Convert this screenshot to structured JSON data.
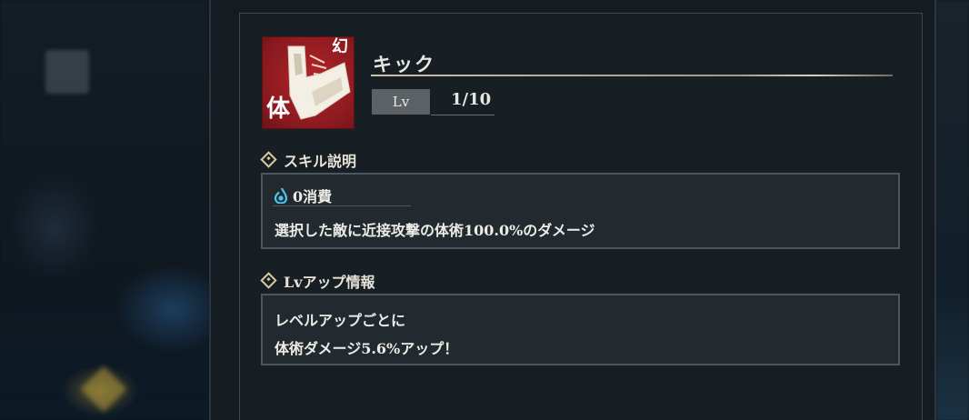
{
  "skill": {
    "name": "キック",
    "icon_kanji": "体",
    "icon_mark": "幻",
    "icon": "kick-skill-icon",
    "level_label": "Lv",
    "level_value": "1/10"
  },
  "description": {
    "title": "スキル説明",
    "cost_icon": "mana-drop-icon",
    "cost": "0消費",
    "text": "選択した敵に近接攻撃の体術100.0%のダメージ"
  },
  "levelup": {
    "title": "Lvアップ情報",
    "lines": [
      "レベルアップごとに",
      "体術ダメージ5.6%アップ！"
    ]
  },
  "colors": {
    "icon_background": "#a81f25",
    "panel_background": "#171e24",
    "box_border": "#4c565e",
    "accent_gold": "#d8c9a0"
  }
}
